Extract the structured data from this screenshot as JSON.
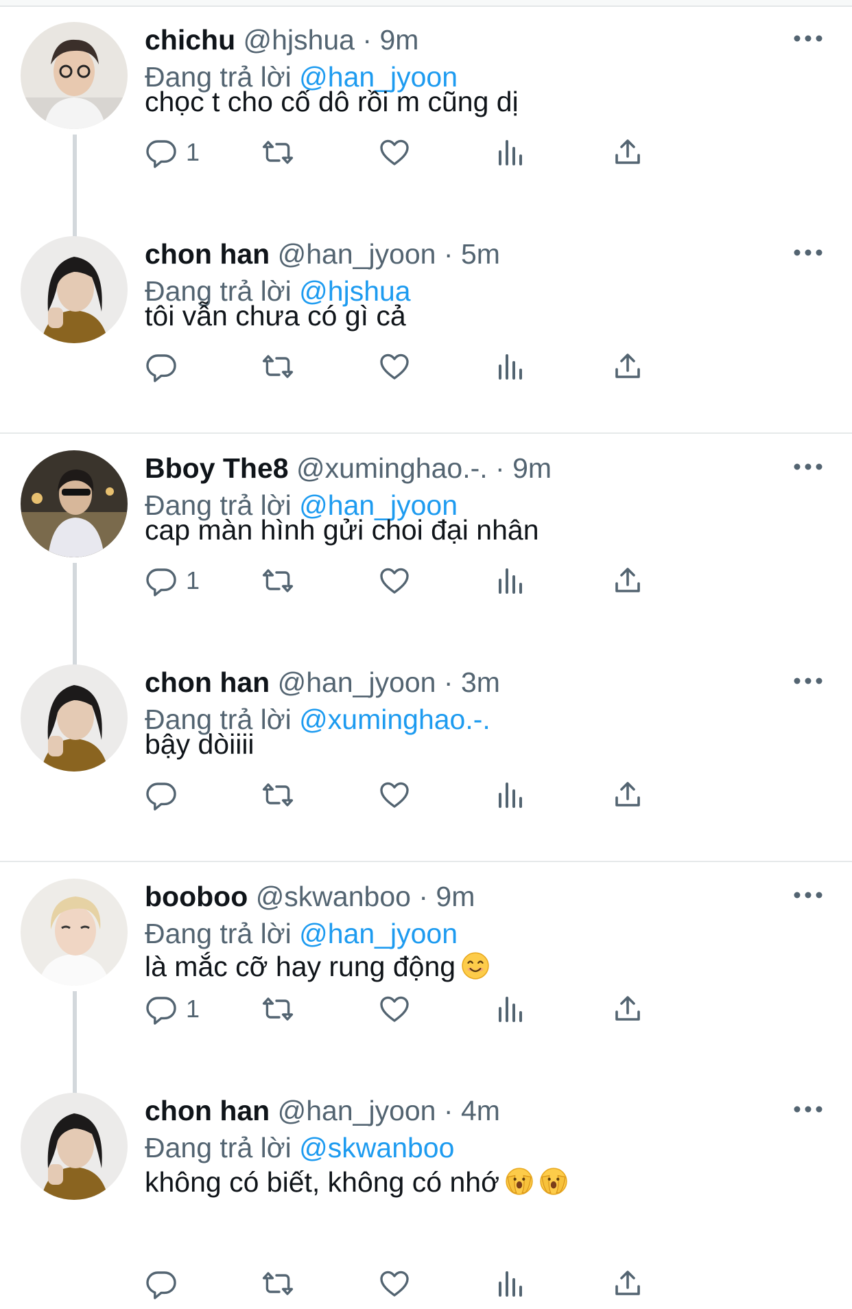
{
  "colors": {
    "link": "#1d9bf0",
    "secondary_text": "#536471",
    "primary_text": "#0f1419",
    "thread_line": "#d3d8dc"
  },
  "icons": [
    "reply-icon",
    "retweet-icon",
    "like-icon",
    "views-icon",
    "share-icon",
    "more-icon"
  ],
  "tweets": [
    {
      "name": "chichu",
      "handle": "@hjshua",
      "dot": "·",
      "time": "9m",
      "reply_prefix": "Đang trả lời",
      "reply_to": "@han_jyoon",
      "text": "chọc t cho cố dô rồi m cũng dị",
      "reply_count": "1"
    },
    {
      "name": "chon han",
      "handle": "@han_jyoon",
      "dot": "·",
      "time": "5m",
      "reply_prefix": "Đang trả lời",
      "reply_to": "@hjshua",
      "text": "tôi vẫn chưa có gì cả",
      "reply_count": ""
    },
    {
      "name": "Bboy The8",
      "handle": "@xuminghao.-.",
      "dot": "·",
      "time": "9m",
      "reply_prefix": "Đang trả lời",
      "reply_to": "@han_jyoon",
      "text": "cap màn hình gửi choi đại nhân",
      "reply_count": "1"
    },
    {
      "name": "chon han",
      "handle": "@han_jyoon",
      "dot": "·",
      "time": "3m",
      "reply_prefix": "Đang trả lời",
      "reply_to": "@xuminghao.-.",
      "text": "bậy dòiiii",
      "reply_count": ""
    },
    {
      "name": "booboo",
      "handle": "@skwanboo",
      "dot": "·",
      "time": "9m",
      "reply_prefix": "Đang trả lời",
      "reply_to": "@han_jyoon",
      "text": "là mắc cỡ hay rung động",
      "emoji": "smiling-face-emoji",
      "reply_count": "1"
    },
    {
      "name": "chon han",
      "handle": "@han_jyoon",
      "dot": "·",
      "time": "4m",
      "reply_prefix": "Đang trả lời",
      "reply_to": "@skwanboo",
      "text": "không có biết, không có nhớ",
      "emoji": "peeking-face-emoji ×2",
      "reply_count": ""
    }
  ]
}
